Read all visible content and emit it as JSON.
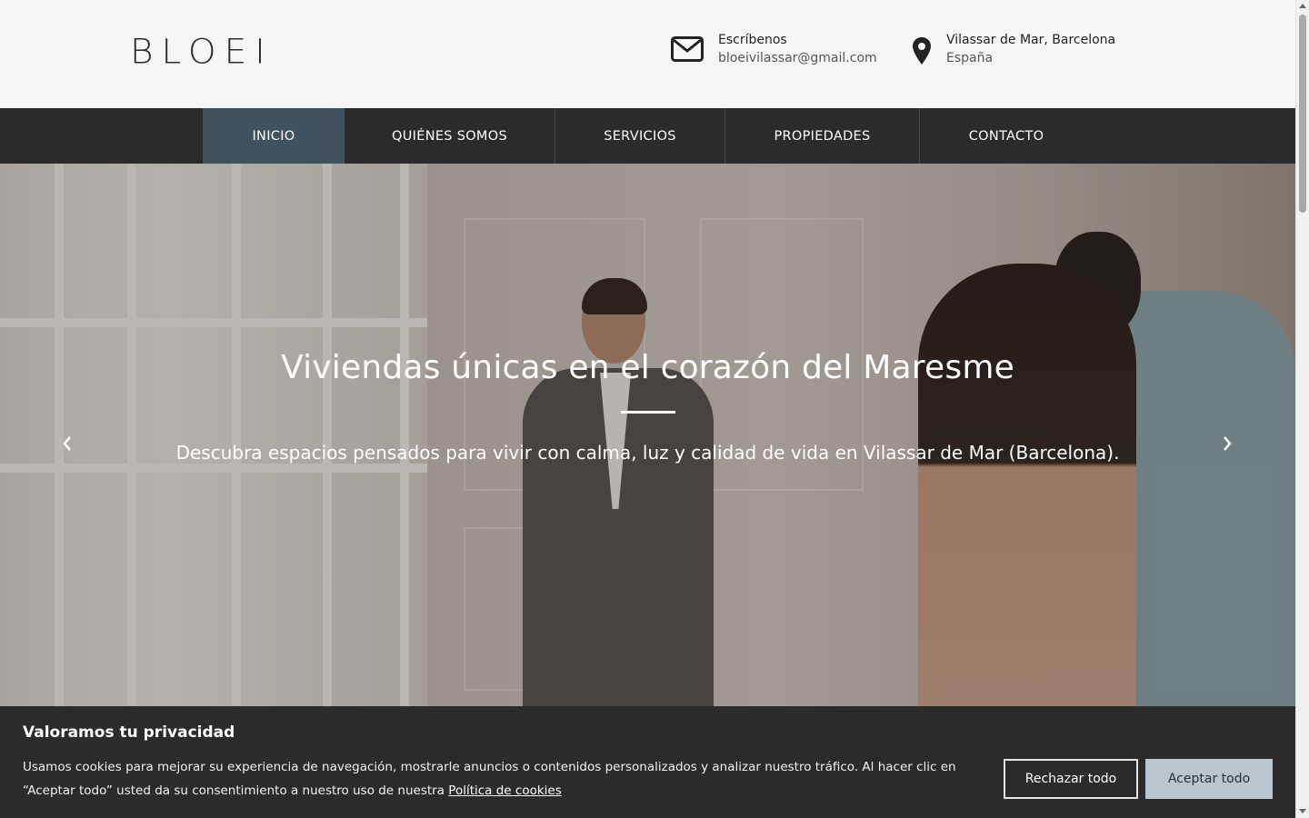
{
  "header": {
    "logo_text": "BLOEI",
    "email": {
      "title": "Escríbenos",
      "value": "bloeivilassar@gmail.com",
      "icon": "envelope-icon"
    },
    "location": {
      "title": "Vilassar de Mar, Barcelona",
      "value": "España",
      "icon": "map-pin-icon"
    }
  },
  "nav": {
    "items": [
      {
        "label": "INICIO",
        "active": true
      },
      {
        "label": "QUIÉNES SOMOS",
        "active": false
      },
      {
        "label": "SERVICIOS",
        "active": false
      },
      {
        "label": "PROPIEDADES",
        "active": false
      },
      {
        "label": "CONTACTO",
        "active": false
      }
    ],
    "active_color": "#3f525e",
    "bg_color": "#2b2b2b"
  },
  "hero": {
    "title": "Viviendas únicas en el corazón del Maresme",
    "subtitle": "Descubra espacios pensados para vivir con calma, luz y calidad de vida en Vilassar de Mar (Barcelona).",
    "prev_icon": "chevron-left-icon",
    "next_icon": "chevron-right-icon"
  },
  "cookie": {
    "title": "Valoramos tu privacidad",
    "text": "Usamos cookies para mejorar su experiencia de navegación, mostrarle anuncios o contenidos personalizados y analizar nuestro tráfico. Al hacer clic en “Aceptar todo” usted da su consentimiento a nuestro uso de nuestra",
    "link_label": "Política de cookies",
    "reject_label": "Rechazar todo",
    "accept_label": "Aceptar todo",
    "accept_color": "#b9c6cf"
  }
}
